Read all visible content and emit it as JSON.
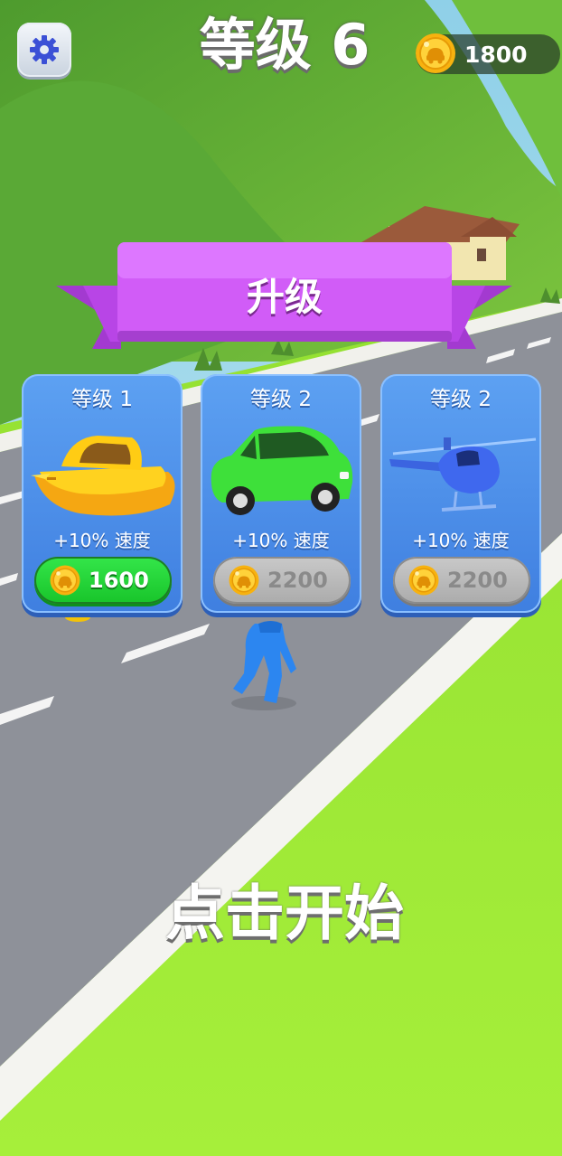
{
  "hud": {
    "level_title": "等级 6",
    "coins": "1800",
    "settings_icon": "gear-icon"
  },
  "upgrade": {
    "banner_title": "升级",
    "cards": [
      {
        "level": "等级 1",
        "vehicle": "yellow-boat",
        "bonus": "+10% 速度",
        "price": "1600",
        "state": "active"
      },
      {
        "level": "等级 2",
        "vehicle": "green-car",
        "bonus": "+10% 速度",
        "price": "2200",
        "state": "disabled"
      },
      {
        "level": "等级 2",
        "vehicle": "blue-helicopter",
        "bonus": "+10% 速度",
        "price": "2200",
        "state": "disabled"
      }
    ]
  },
  "start_prompt": "点击开始",
  "colors": {
    "grass": "#a1ec36",
    "road": "#8c8f98",
    "card_blue": "#4a8cec",
    "banner_purple": "#c84df0",
    "buy_green": "#22d233",
    "coin_gold": "#ffc51a"
  }
}
